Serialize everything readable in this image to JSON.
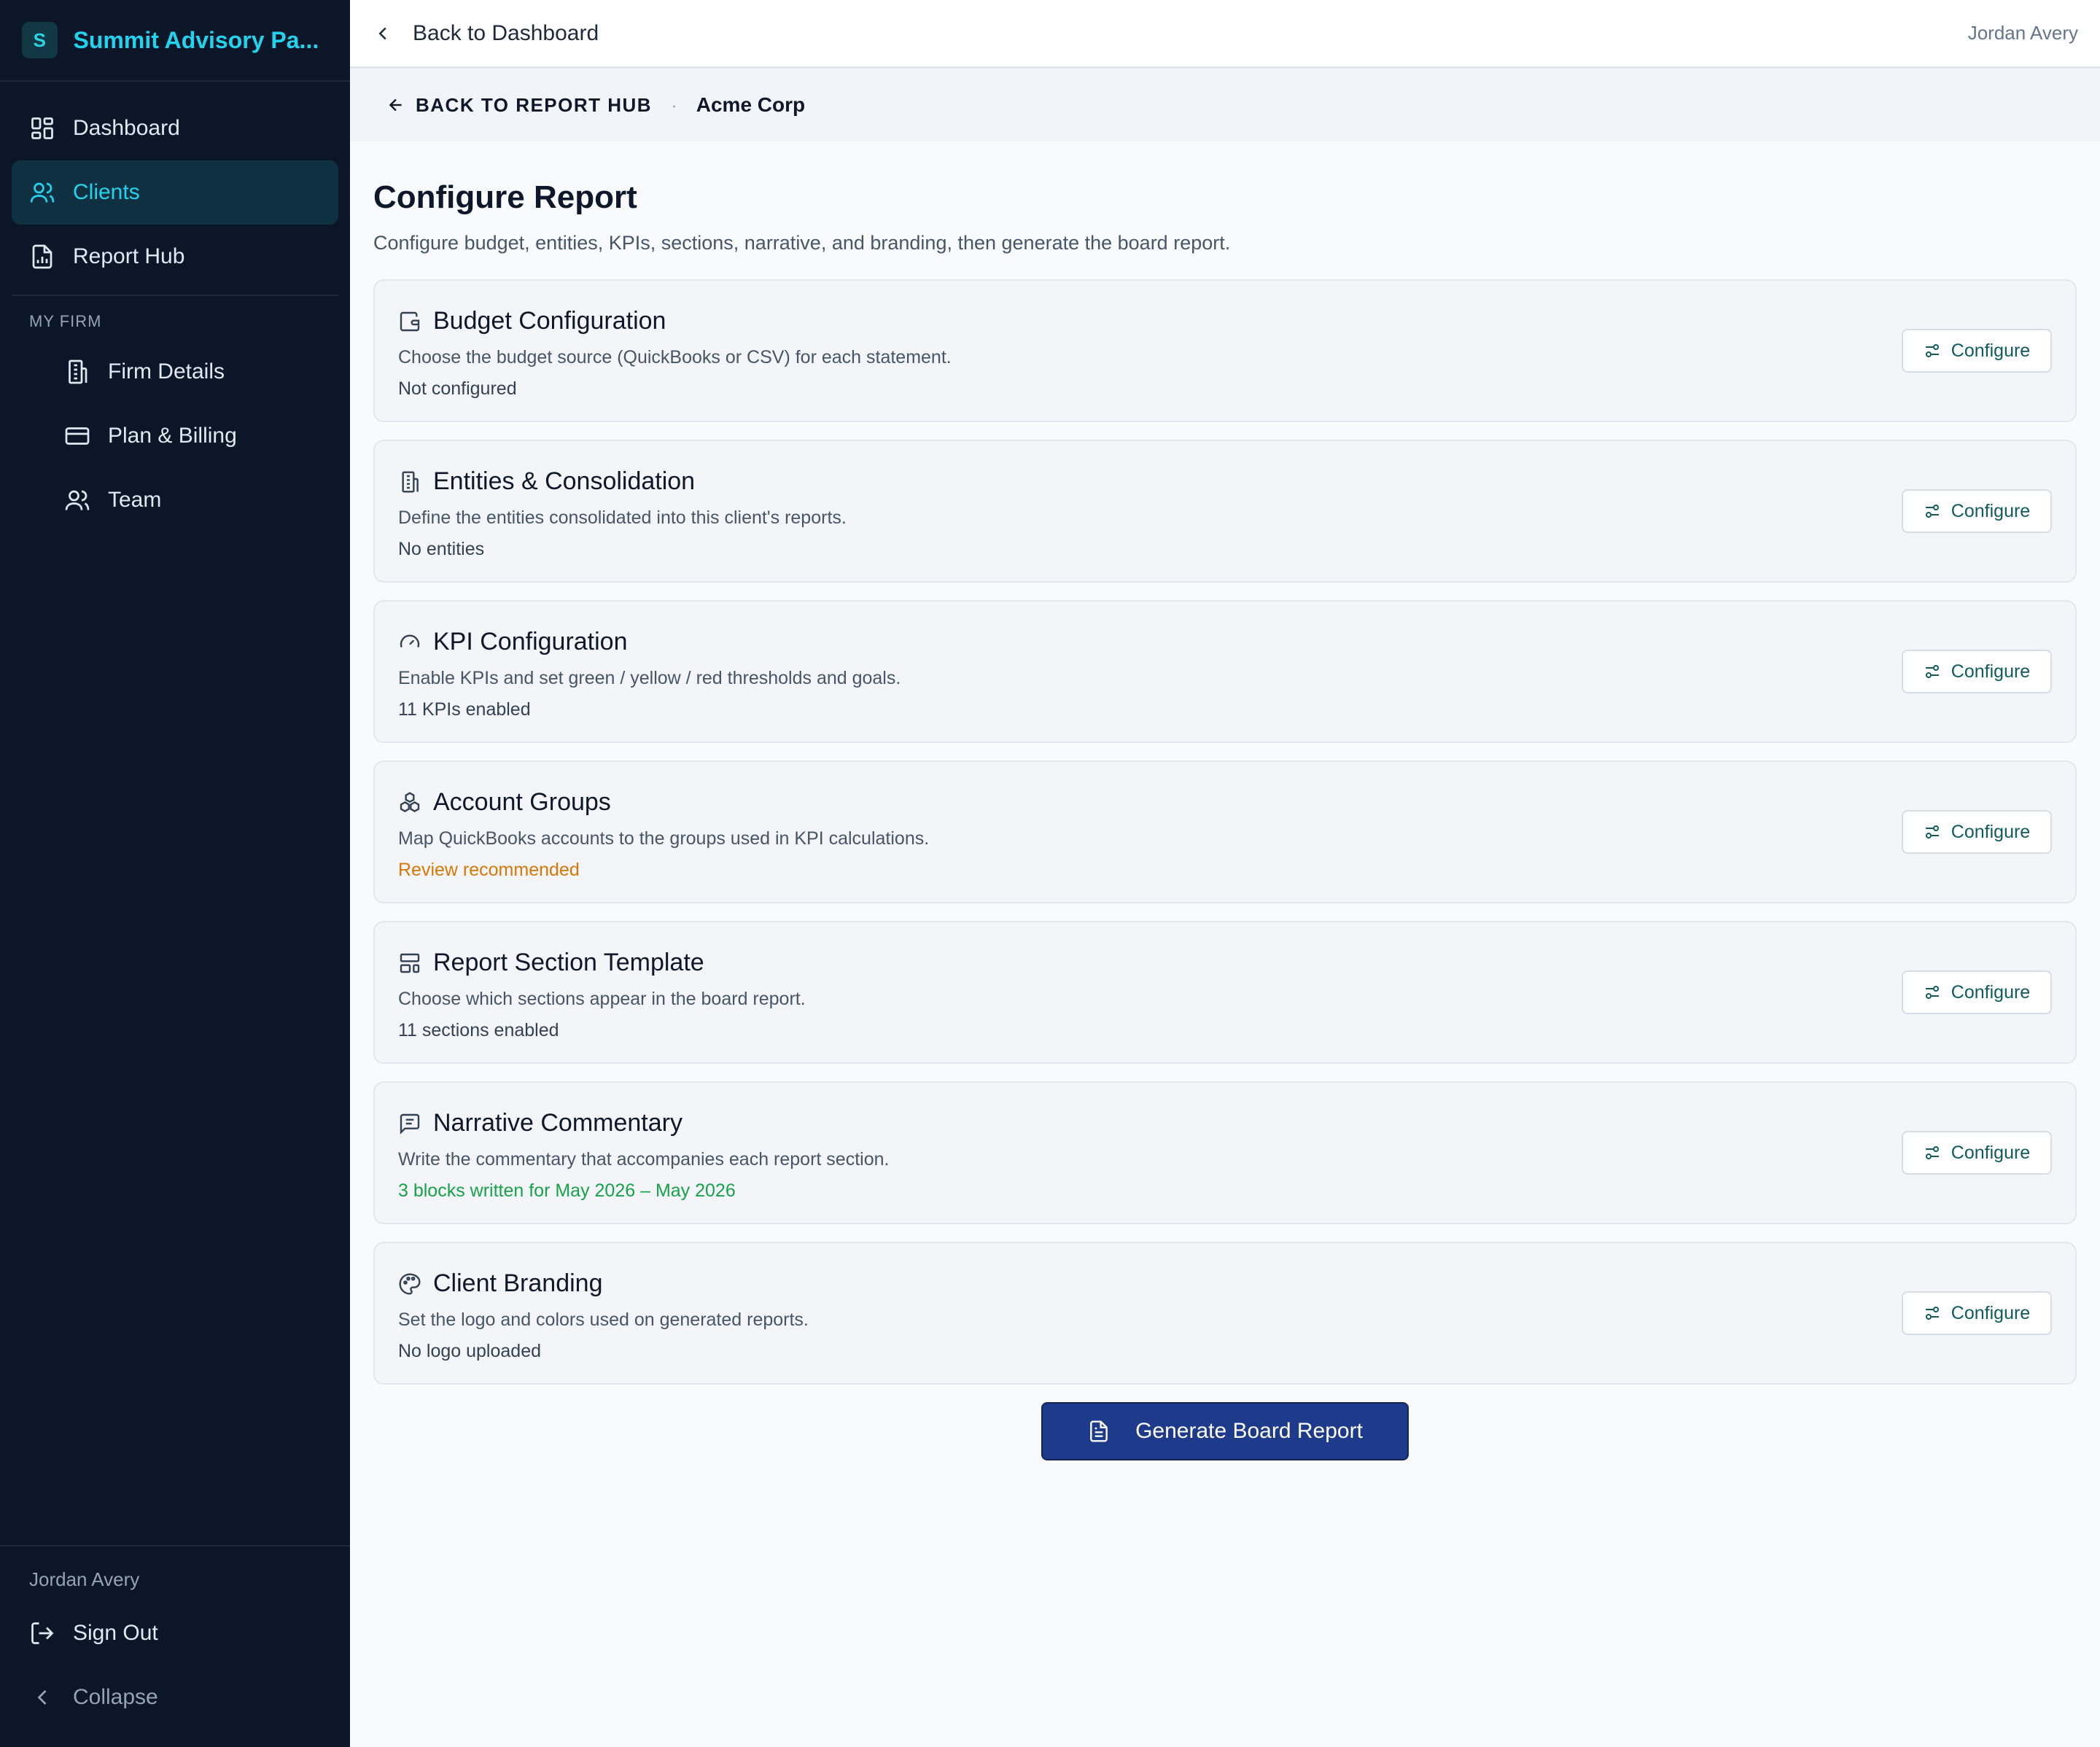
{
  "sidebar": {
    "brand_badge": "S",
    "brand_name": "Summit Advisory Pa...",
    "nav": [
      {
        "label": "Dashboard",
        "icon": "dashboard-icon"
      },
      {
        "label": "Clients",
        "icon": "users-icon",
        "active": true
      },
      {
        "label": "Report Hub",
        "icon": "report-file-icon"
      }
    ],
    "section_label": "MY FIRM",
    "firm_items": [
      {
        "label": "Firm Details",
        "icon": "building-icon"
      },
      {
        "label": "Plan & Billing",
        "icon": "credit-card-icon"
      },
      {
        "label": "Team",
        "icon": "team-icon"
      }
    ],
    "user_name": "Jordan Avery",
    "sign_out": "Sign Out",
    "collapse": "Collapse"
  },
  "topbar": {
    "back_label": "Back to Dashboard",
    "user_name": "Jordan Avery"
  },
  "subbar": {
    "back_hub_label": "BACK TO REPORT HUB",
    "separator": "·",
    "client_name": "Acme Corp"
  },
  "page": {
    "title": "Configure Report",
    "subtitle": "Configure budget, entities, KPIs, sections, narrative, and branding, then generate the board report."
  },
  "cards": [
    {
      "title": "Budget Configuration",
      "desc": "Choose the budget source (QuickBooks or CSV) for each statement.",
      "status": "Not configured",
      "icon": "wallet-icon",
      "button": "Configure"
    },
    {
      "title": "Entities & Consolidation",
      "desc": "Define the entities consolidated into this client's reports.",
      "status": "No entities",
      "icon": "building-icon",
      "button": "Configure"
    },
    {
      "title": "KPI Configuration",
      "desc": "Enable KPIs and set green / yellow / red thresholds and goals.",
      "status": "11 KPIs enabled",
      "icon": "gauge-icon",
      "button": "Configure"
    },
    {
      "title": "Account Groups",
      "desc": "Map QuickBooks accounts to the groups used in KPI calculations.",
      "status": "Review recommended",
      "icon": "boxes-icon",
      "button": "Configure"
    },
    {
      "title": "Report Section Template",
      "desc": "Choose which sections appear in the board report.",
      "status": "11 sections enabled",
      "icon": "layout-template-icon",
      "button": "Configure"
    },
    {
      "title": "Narrative Commentary",
      "desc": "Write the commentary that accompanies each report section.",
      "status": "3 blocks written for May 2026 – May 2026",
      "icon": "message-square-icon",
      "button": "Configure"
    },
    {
      "title": "Client Branding",
      "desc": "Set the logo and colors used on generated reports.",
      "status": "No logo uploaded",
      "icon": "palette-icon",
      "button": "Configure"
    }
  ],
  "generate_button": "Generate Board Report",
  "colors": {
    "sidebar_bg": "#0b1729",
    "accent_cyan": "#22d3ee",
    "primary_navy": "#1e3a8a",
    "status_warn": "#d97706",
    "status_ok": "#16a34a",
    "configure_text": "#0f5b5e"
  }
}
